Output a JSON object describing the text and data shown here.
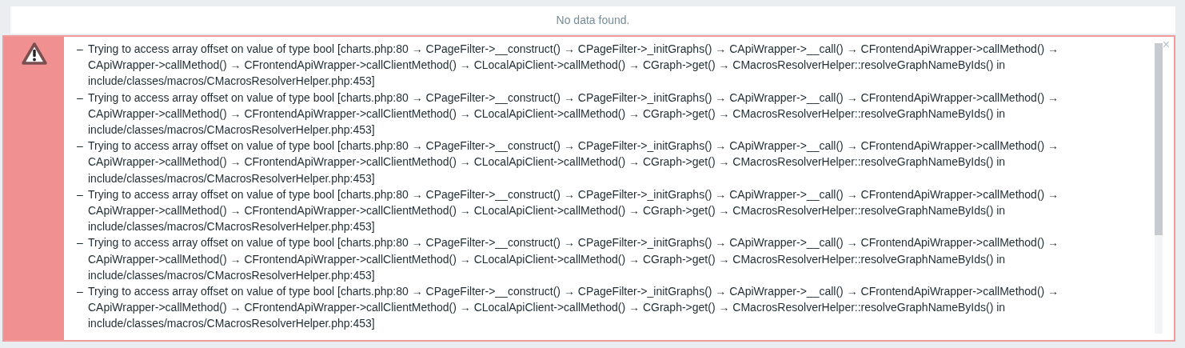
{
  "table": {
    "empty_message": "No data found."
  },
  "error_box": {
    "close": "×",
    "messages": [
      {
        "bullet": "–",
        "text": "Trying to access array offset on value of type bool [charts.php:80 → CPageFilter->__construct() → CPageFilter->_initGraphs() → CApiWrapper->__call() → CFrontendApiWrapper->callMethod() → CApiWrapper->callMethod() → CFrontendApiWrapper->callClientMethod() → CLocalApiClient->callMethod() → CGraph->get() → CMacrosResolverHelper::resolveGraphNameByIds() in include/classes/macros/CMacrosResolverHelper.php:453]"
      },
      {
        "bullet": "–",
        "text": "Trying to access array offset on value of type bool [charts.php:80 → CPageFilter->__construct() → CPageFilter->_initGraphs() → CApiWrapper->__call() → CFrontendApiWrapper->callMethod() → CApiWrapper->callMethod() → CFrontendApiWrapper->callClientMethod() → CLocalApiClient->callMethod() → CGraph->get() → CMacrosResolverHelper::resolveGraphNameByIds() in include/classes/macros/CMacrosResolverHelper.php:453]"
      },
      {
        "bullet": "–",
        "text": "Trying to access array offset on value of type bool [charts.php:80 → CPageFilter->__construct() → CPageFilter->_initGraphs() → CApiWrapper->__call() → CFrontendApiWrapper->callMethod() → CApiWrapper->callMethod() → CFrontendApiWrapper->callClientMethod() → CLocalApiClient->callMethod() → CGraph->get() → CMacrosResolverHelper::resolveGraphNameByIds() in include/classes/macros/CMacrosResolverHelper.php:453]"
      },
      {
        "bullet": "–",
        "text": "Trying to access array offset on value of type bool [charts.php:80 → CPageFilter->__construct() → CPageFilter->_initGraphs() → CApiWrapper->__call() → CFrontendApiWrapper->callMethod() → CApiWrapper->callMethod() → CFrontendApiWrapper->callClientMethod() → CLocalApiClient->callMethod() → CGraph->get() → CMacrosResolverHelper::resolveGraphNameByIds() in include/classes/macros/CMacrosResolverHelper.php:453]"
      },
      {
        "bullet": "–",
        "text": "Trying to access array offset on value of type bool [charts.php:80 → CPageFilter->__construct() → CPageFilter->_initGraphs() → CApiWrapper->__call() → CFrontendApiWrapper->callMethod() → CApiWrapper->callMethod() → CFrontendApiWrapper->callClientMethod() → CLocalApiClient->callMethod() → CGraph->get() → CMacrosResolverHelper::resolveGraphNameByIds() in include/classes/macros/CMacrosResolverHelper.php:453]"
      },
      {
        "bullet": "–",
        "text": "Trying to access array offset on value of type bool [charts.php:80 → CPageFilter->__construct() → CPageFilter->_initGraphs() → CApiWrapper->__call() → CFrontendApiWrapper->callMethod() → CApiWrapper->callMethod() → CFrontendApiWrapper->callClientMethod() → CLocalApiClient->callMethod() → CGraph->get() → CMacrosResolverHelper::resolveGraphNameByIds() in include/classes/macros/CMacrosResolverHelper.php:453]"
      }
    ]
  }
}
